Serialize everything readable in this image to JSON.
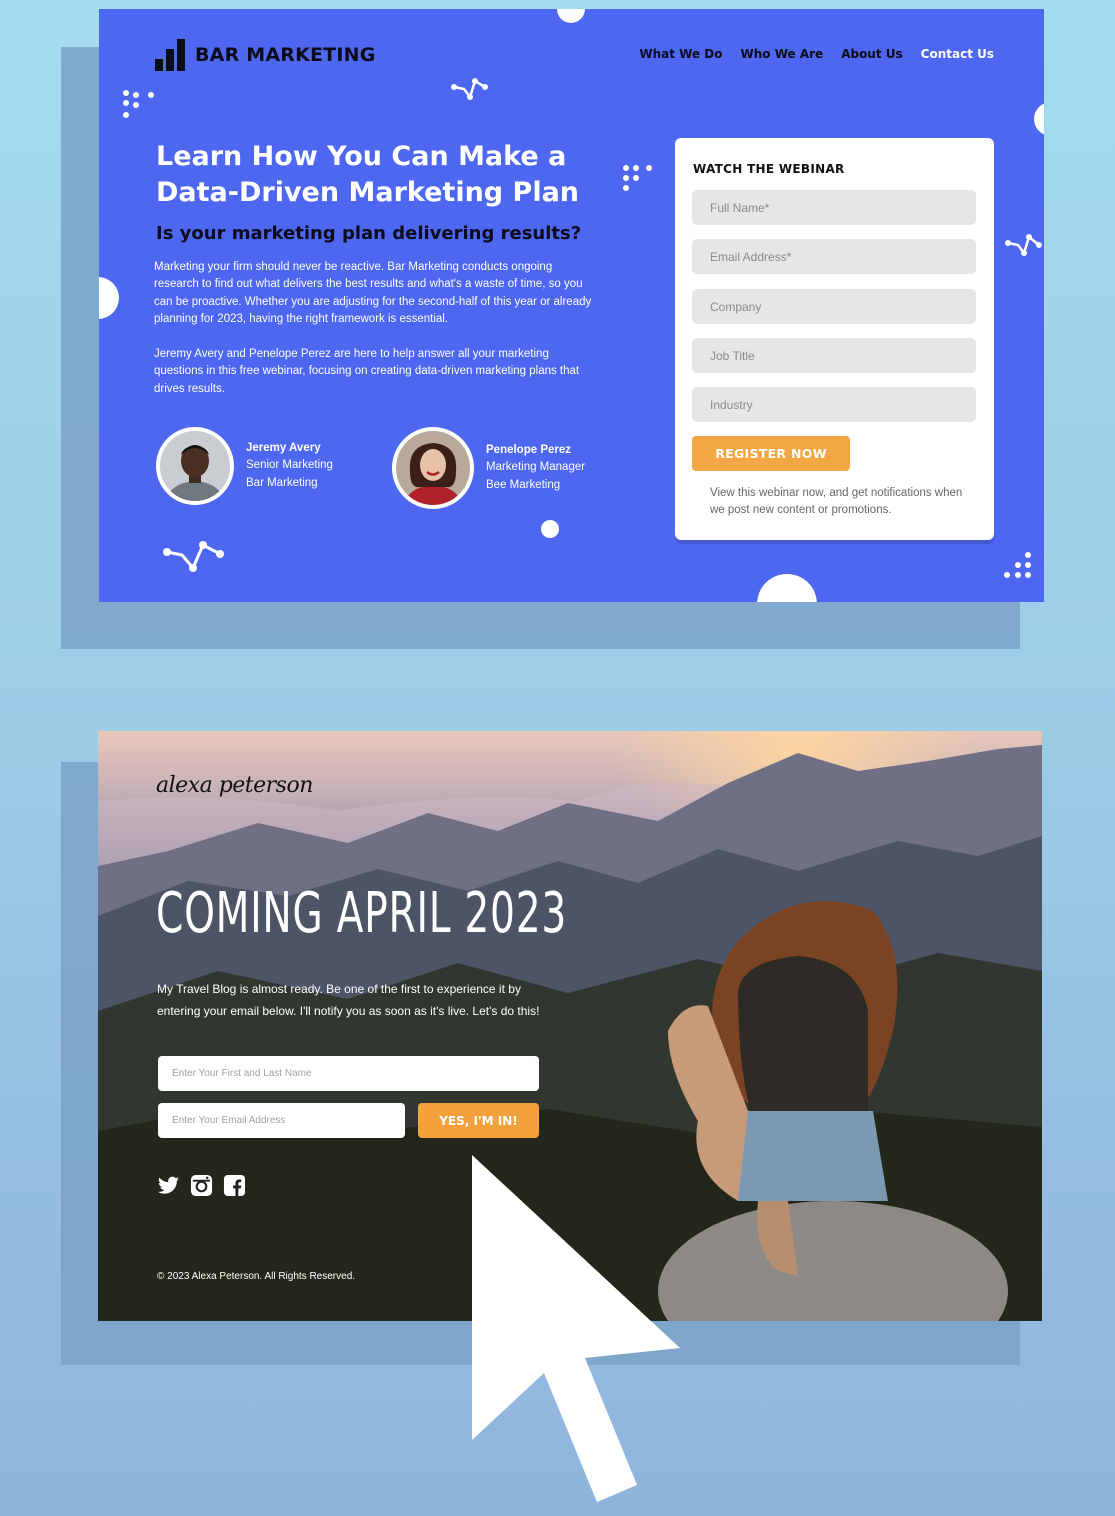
{
  "card1": {
    "brand": "BAR MARKETING",
    "nav": [
      "What We Do",
      "Who We Are",
      "About Us",
      "Contact Us"
    ],
    "headline": "Learn How You Can Make a Data-Driven Marketing Plan",
    "subheadline": "Is your marketing plan delivering results?",
    "paragraph1": "Marketing your firm should never be reactive. Bar Marketing conducts ongoing research to find out what delivers the best results and what's a waste of time, so you can be proactive. Whether you are adjusting for the second-half of this year or already planning for 2023, having the right framework is essential.",
    "paragraph2": "Jeremy Avery and Penelope Perez are here to help answer all your marketing questions in this free webinar, focusing on creating data-driven marketing plans that drives results.",
    "speakers": [
      {
        "name": "Jeremy Avery",
        "title": "Senior Marketing",
        "company": "Bar Marketing"
      },
      {
        "name": "Penelope Perez",
        "title": "Marketing Manager",
        "company": "Bee Marketing"
      }
    ],
    "form": {
      "title": "WATCH THE WEBINAR",
      "fields": [
        "Full Name*",
        "Email Address*",
        "Company",
        "Job Title",
        "Industry"
      ],
      "button": "REGISTER NOW",
      "note": "View this webinar now, and get notifications when we post new content or promotions."
    },
    "colors": {
      "background": "#4d67f0",
      "button": "#f2a744"
    }
  },
  "card2": {
    "brand": "alexa peterson",
    "headline": "COMING APRIL 2023",
    "blurb": "My Travel Blog is almost ready. Be one of the first to experience it by entering your email below. I'll notify you as soon as it's live. Let's do this!",
    "name_placeholder": "Enter Your First and Last Name",
    "email_placeholder": "Enter Your Email Address",
    "button": "YES, I'M IN!",
    "social_icons": [
      "twitter-icon",
      "instagram-icon",
      "facebook-icon"
    ],
    "copyright": "© 2023 Alexa Peterson. All Rights Reserved.",
    "colors": {
      "button": "#f2a13c"
    }
  }
}
